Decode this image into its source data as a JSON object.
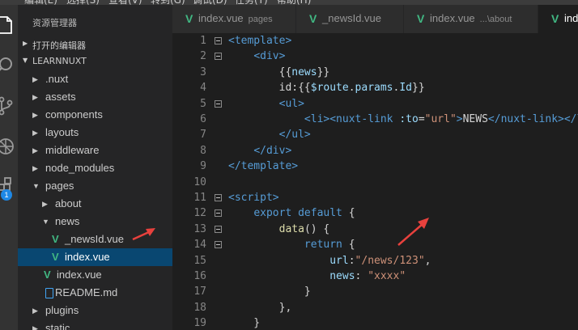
{
  "menubar": [
    "编辑(E)",
    "选择(S)",
    "查看(V)",
    "转到(G)",
    "调试(D)",
    "任务(T)",
    "帮助(H)"
  ],
  "activity": {
    "icons": [
      "files-icon",
      "search-icon",
      "source-control-icon",
      "debug-icon",
      "extensions-icon"
    ],
    "badge": "1"
  },
  "sidebar": {
    "title": "资源管理器",
    "open_editors": "打开的编辑器",
    "project": "LEARNNUXT",
    "items": [
      {
        "label": ".nuxt",
        "kind": "folder",
        "expanded": false,
        "depth": 1
      },
      {
        "label": "assets",
        "kind": "folder",
        "expanded": false,
        "depth": 1
      },
      {
        "label": "components",
        "kind": "folder",
        "expanded": false,
        "depth": 1
      },
      {
        "label": "layouts",
        "kind": "folder",
        "expanded": false,
        "depth": 1
      },
      {
        "label": "middleware",
        "kind": "folder",
        "expanded": false,
        "depth": 1
      },
      {
        "label": "node_modules",
        "kind": "folder",
        "expanded": false,
        "depth": 1
      },
      {
        "label": "pages",
        "kind": "folder",
        "expanded": true,
        "depth": 1
      },
      {
        "label": "about",
        "kind": "folder",
        "expanded": false,
        "depth": 2
      },
      {
        "label": "news",
        "kind": "folder",
        "expanded": true,
        "depth": 2
      },
      {
        "label": "_newsId.vue",
        "kind": "vue",
        "depth": 3
      },
      {
        "label": "index.vue",
        "kind": "vue",
        "depth": 3,
        "selected": true
      },
      {
        "label": "index.vue",
        "kind": "vue",
        "depth": 2
      },
      {
        "label": "README.md",
        "kind": "md",
        "depth": 2
      },
      {
        "label": "plugins",
        "kind": "folder",
        "expanded": false,
        "depth": 1
      },
      {
        "label": "static",
        "kind": "folder",
        "expanded": false,
        "depth": 1
      }
    ]
  },
  "tabs": [
    {
      "name": "index.vue",
      "hint": "pages",
      "active": false
    },
    {
      "name": "_newsId.vue",
      "hint": "",
      "active": false
    },
    {
      "name": "index.vue",
      "hint": "...\\about",
      "active": false
    },
    {
      "name": "index.vue",
      "hint": "",
      "active": true
    }
  ],
  "editor": {
    "lines": [
      {
        "n": "1",
        "fold": true,
        "tokens": [
          [
            "tag",
            "<template>"
          ]
        ]
      },
      {
        "n": "2",
        "fold": true,
        "tokens": [
          [
            "txt",
            "    "
          ],
          [
            "tag",
            "<div>"
          ]
        ]
      },
      {
        "n": "3",
        "fold": false,
        "tokens": [
          [
            "txt",
            "        {{"
          ],
          [
            "var",
            "news"
          ],
          [
            "txt",
            "}}"
          ]
        ]
      },
      {
        "n": "4",
        "fold": false,
        "tokens": [
          [
            "txt",
            "        id:{{"
          ],
          [
            "var",
            "$route"
          ],
          [
            "txt",
            "."
          ],
          [
            "var",
            "params"
          ],
          [
            "txt",
            "."
          ],
          [
            "var",
            "Id"
          ],
          [
            "txt",
            "}}"
          ]
        ]
      },
      {
        "n": "5",
        "fold": true,
        "tokens": [
          [
            "txt",
            "        "
          ],
          [
            "tag",
            "<ul>"
          ]
        ]
      },
      {
        "n": "6",
        "fold": false,
        "tokens": [
          [
            "txt",
            "            "
          ],
          [
            "tag",
            "<li><nuxt-link"
          ],
          [
            "txt",
            " "
          ],
          [
            "attr",
            ":to"
          ],
          [
            "txt",
            "="
          ],
          [
            "str",
            "\"url\""
          ],
          [
            "tag",
            ">"
          ],
          [
            "txt",
            "NEWS"
          ],
          [
            "tag",
            "</nuxt-link></li>"
          ]
        ]
      },
      {
        "n": "7",
        "fold": false,
        "tokens": [
          [
            "txt",
            "        "
          ],
          [
            "tag",
            "</ul>"
          ]
        ]
      },
      {
        "n": "8",
        "fold": false,
        "tokens": [
          [
            "txt",
            "    "
          ],
          [
            "tag",
            "</div>"
          ]
        ]
      },
      {
        "n": "9",
        "fold": false,
        "tokens": [
          [
            "tag",
            "</template>"
          ]
        ]
      },
      {
        "n": "10",
        "fold": false,
        "tokens": []
      },
      {
        "n": "11",
        "fold": true,
        "tokens": [
          [
            "tag",
            "<script>"
          ]
        ]
      },
      {
        "n": "12",
        "fold": true,
        "tokens": [
          [
            "txt",
            "    "
          ],
          [
            "kw",
            "export default"
          ],
          [
            "txt",
            " {"
          ]
        ]
      },
      {
        "n": "13",
        "fold": true,
        "tokens": [
          [
            "txt",
            "        "
          ],
          [
            "fn",
            "data"
          ],
          [
            "txt",
            "() {"
          ]
        ]
      },
      {
        "n": "14",
        "fold": true,
        "tokens": [
          [
            "txt",
            "            "
          ],
          [
            "kw",
            "return"
          ],
          [
            "txt",
            " {"
          ]
        ]
      },
      {
        "n": "15",
        "fold": false,
        "tokens": [
          [
            "txt",
            "                "
          ],
          [
            "var",
            "url"
          ],
          [
            "txt",
            ":"
          ],
          [
            "str",
            "\"/news/123\""
          ],
          [
            "txt",
            ","
          ]
        ]
      },
      {
        "n": "16",
        "fold": false,
        "tokens": [
          [
            "txt",
            "                "
          ],
          [
            "var",
            "news"
          ],
          [
            "txt",
            ": "
          ],
          [
            "str",
            "\"xxxx\""
          ]
        ]
      },
      {
        "n": "17",
        "fold": false,
        "tokens": [
          [
            "txt",
            "            }"
          ]
        ]
      },
      {
        "n": "18",
        "fold": false,
        "tokens": [
          [
            "txt",
            "        },"
          ]
        ]
      },
      {
        "n": "19",
        "fold": false,
        "tokens": [
          [
            "txt",
            "    }"
          ]
        ]
      }
    ]
  },
  "colors": {
    "vue": "#41b883",
    "selection": "#094771",
    "arrow": "#e8413d",
    "badge": "#1e88e5"
  }
}
